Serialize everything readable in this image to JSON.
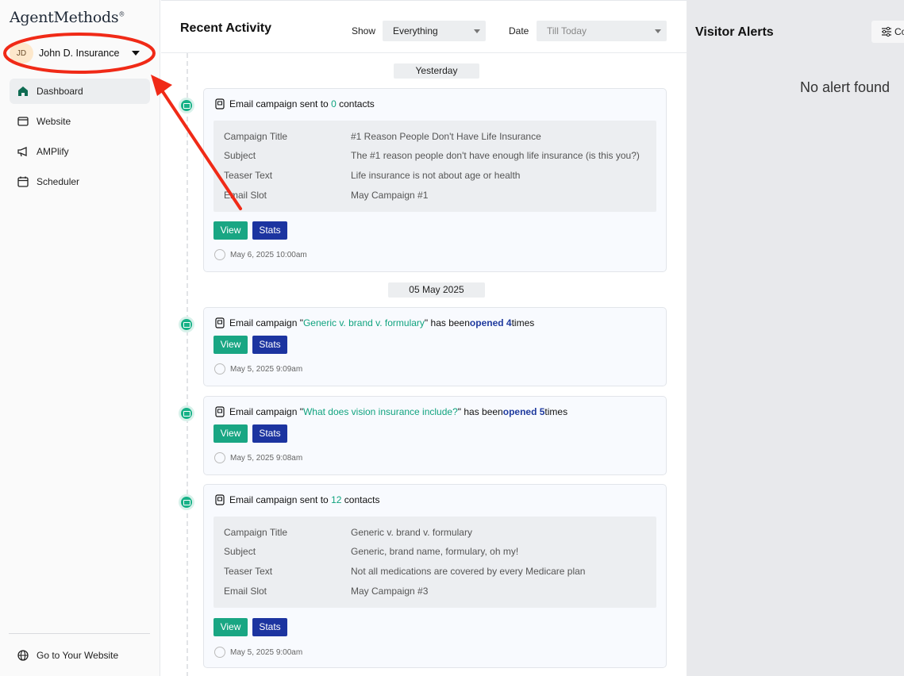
{
  "brand": {
    "logo_text": "AgentMethods",
    "logo_mark": "®"
  },
  "account": {
    "initials": "JD",
    "name": "John D. Insurance"
  },
  "sidebar": {
    "items": [
      {
        "label": "Dashboard",
        "icon": "home-icon"
      },
      {
        "label": "Website",
        "icon": "browser-icon"
      },
      {
        "label": "AMPlify",
        "icon": "megaphone-icon"
      },
      {
        "label": "Scheduler",
        "icon": "calendar-icon"
      }
    ],
    "footer_link": "Go to Your Website"
  },
  "activity": {
    "title": "Recent Activity",
    "show_label": "Show",
    "show_value": "Everything",
    "date_label": "Date",
    "date_value": "Till Today",
    "groups": [
      "Yesterday",
      "05 May 2025"
    ],
    "cards": [
      {
        "prefix": "Email campaign sent to ",
        "highlight": "0",
        "suffix": " contacts",
        "details": [
          {
            "k": "Campaign Title",
            "v": "#1 Reason People Don't Have Life Insurance"
          },
          {
            "k": "Subject",
            "v": "The #1 reason people don't have enough life insurance (is this you?)"
          },
          {
            "k": "Teaser Text",
            "v": "Life insurance is not about age or health"
          },
          {
            "k": "Email Slot",
            "v": "May Campaign #1"
          }
        ],
        "view": "View",
        "stats": "Stats",
        "time": "May 6, 2025 10:00am"
      },
      {
        "prefix": "Email campaign \"",
        "highlight": "Generic v. brand v. formulary",
        "middle": "\" has been ",
        "opened": "opened 4",
        "suffix": " times",
        "view": "View",
        "stats": "Stats",
        "time": "May 5, 2025 9:09am"
      },
      {
        "prefix": "Email campaign \"",
        "highlight": "What does vision insurance include?",
        "middle": "\" has been ",
        "opened": "opened 5",
        "suffix": " times",
        "view": "View",
        "stats": "Stats",
        "time": "May 5, 2025 9:08am"
      },
      {
        "prefix": "Email campaign sent to ",
        "highlight": "12",
        "suffix": " contacts",
        "details": [
          {
            "k": "Campaign Title",
            "v": "Generic v. brand v. formulary"
          },
          {
            "k": "Subject",
            "v": "Generic, brand name, formulary, oh my!"
          },
          {
            "k": "Teaser Text",
            "v": "Not all medications are covered by every Medicare plan"
          },
          {
            "k": "Email Slot",
            "v": "May Campaign #3"
          }
        ],
        "view": "View",
        "stats": "Stats",
        "time": "May 5, 2025 9:00am"
      }
    ]
  },
  "alerts": {
    "title": "Visitor Alerts",
    "config_label": "Co",
    "empty_text": "No alert found"
  },
  "colors": {
    "accent_green": "#19a683",
    "accent_blue": "#1c34a0",
    "annotation_red": "#f02a17"
  }
}
